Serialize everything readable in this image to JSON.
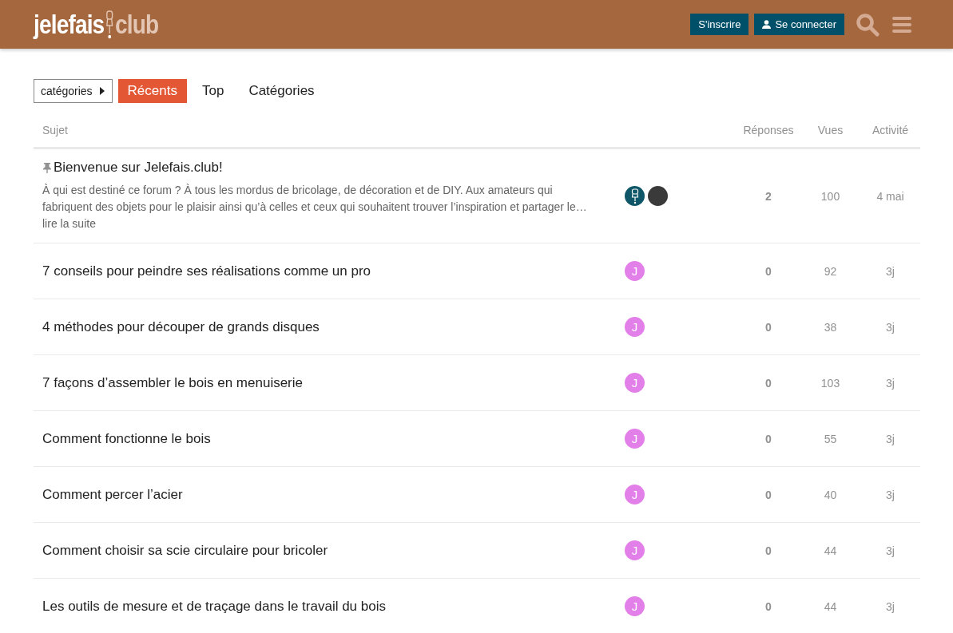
{
  "header": {
    "logo": {
      "word_1": "jelefais",
      "word_2": "club"
    },
    "buttons": [
      {
        "label": "S'inscrire",
        "kind": "plain"
      },
      {
        "label": "Se connecter",
        "kind": "user"
      }
    ]
  },
  "nav": {
    "category_dropdown": "catégories",
    "tabs": [
      {
        "label": "Récents",
        "selected": true
      },
      {
        "label": "Top",
        "selected": false
      },
      {
        "label": "Catégories",
        "selected": false
      }
    ]
  },
  "table": {
    "columns": [
      "Sujet",
      "Réponses",
      "Vues",
      "Activité"
    ],
    "rows": [
      {
        "title": "Bienvenue sur Jelefais.club!",
        "pinned": true,
        "excerpt": "À qui est destiné ce forum ? À tous les mordus de bricolage, de décoration et de DIY. Aux amateurs qui fabriquent des objets pour le plaisir ainsi qu’à celles et ceux qui souhaitent trouver l’inspiration et partager le… ",
        "read_more": "lire la suite",
        "posters": [
          {
            "kind": "logo"
          },
          {
            "kind": "photo"
          }
        ],
        "replies": "2",
        "views": "100",
        "activity": "4 mai"
      },
      {
        "title": "7 conseils pour peindre ses réalisations comme un pro",
        "pinned": false,
        "posters": [
          {
            "kind": "letter",
            "letter": "J",
            "color": "#e27fe8"
          }
        ],
        "replies": "0",
        "views": "92",
        "activity": "3j"
      },
      {
        "title": "4 méthodes pour découper de grands disques",
        "pinned": false,
        "posters": [
          {
            "kind": "letter",
            "letter": "J",
            "color": "#e27fe8"
          }
        ],
        "replies": "0",
        "views": "38",
        "activity": "3j"
      },
      {
        "title": "7 façons d’assembler le bois en menuiserie",
        "pinned": false,
        "posters": [
          {
            "kind": "letter",
            "letter": "J",
            "color": "#e27fe8"
          }
        ],
        "replies": "0",
        "views": "103",
        "activity": "3j"
      },
      {
        "title": "Comment fonctionne le bois",
        "pinned": false,
        "posters": [
          {
            "kind": "letter",
            "letter": "J",
            "color": "#e27fe8"
          }
        ],
        "replies": "0",
        "views": "55",
        "activity": "3j"
      },
      {
        "title": "Comment percer l’acier",
        "pinned": false,
        "posters": [
          {
            "kind": "letter",
            "letter": "J",
            "color": "#e27fe8"
          }
        ],
        "replies": "0",
        "views": "40",
        "activity": "3j"
      },
      {
        "title": "Comment choisir sa scie circulaire pour bricoler",
        "pinned": false,
        "posters": [
          {
            "kind": "letter",
            "letter": "J",
            "color": "#e27fe8"
          }
        ],
        "replies": "0",
        "views": "44",
        "activity": "3j"
      },
      {
        "title": "Les outils de mesure et de traçage dans le travail du bois",
        "pinned": false,
        "posters": [
          {
            "kind": "letter",
            "letter": "J",
            "color": "#e27fe8"
          }
        ],
        "replies": "0",
        "views": "44",
        "activity": "3j"
      }
    ]
  }
}
